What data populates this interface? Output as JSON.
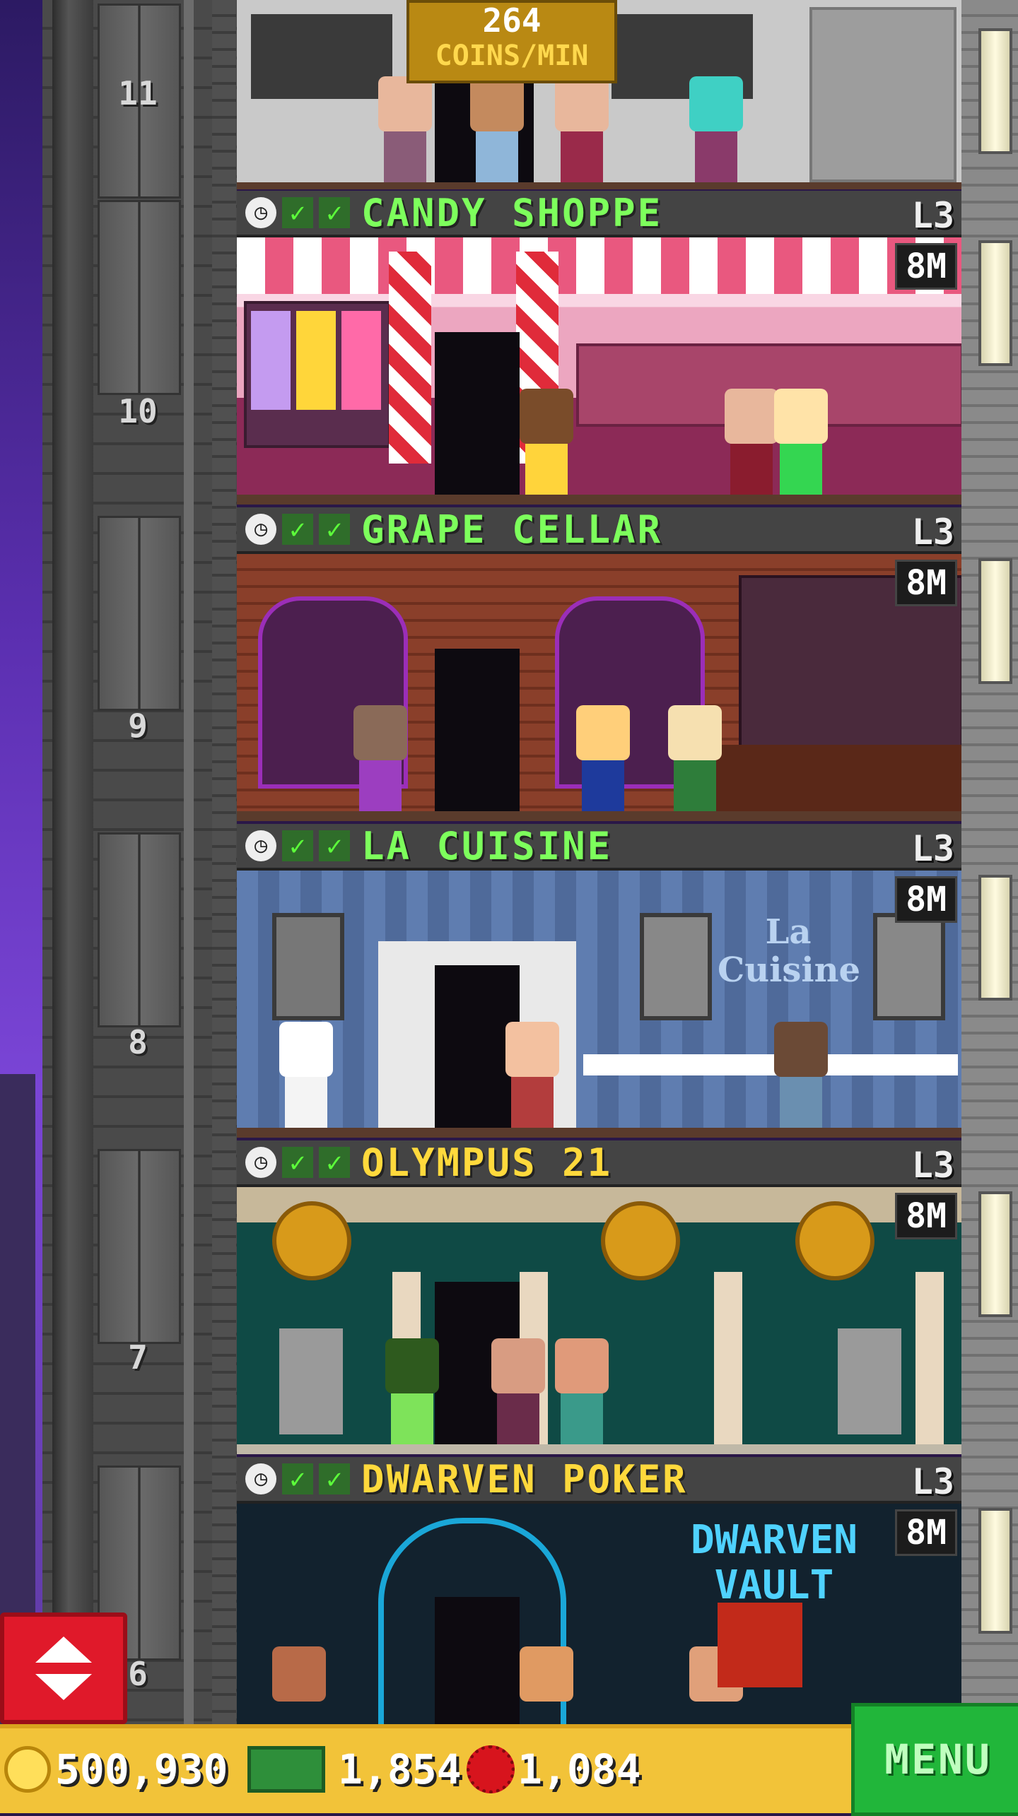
{
  "income": {
    "value": "264",
    "unit": "COINS/MIN"
  },
  "floors": [
    {
      "number": "11"
    },
    {
      "number": "10",
      "name": "CANDY SHOPPE",
      "level": "L3",
      "stock": "8M",
      "name_color": "#7dff5c"
    },
    {
      "number": "9",
      "name": "GRAPE CELLAR",
      "level": "L3",
      "stock": "8M",
      "name_color": "#7dff5c"
    },
    {
      "number": "8",
      "name": "LA CUISINE",
      "level": "L3",
      "stock": "8M",
      "name_color": "#7dff5c"
    },
    {
      "number": "7",
      "name": "OLYMPUS 21",
      "level": "L3",
      "stock": "8M",
      "name_color": "#ffd93c"
    },
    {
      "number": "6",
      "name": "DWARVEN POKER",
      "level": "L3",
      "stock": "8M",
      "name_color": "#ffd93c"
    }
  ],
  "signs": {
    "la_cuisine": "La Cuisine",
    "dwarven": "DWARVEN VAULT"
  },
  "resources": {
    "coins": "500,930",
    "cash": "1,854",
    "bux": "1,084"
  },
  "menu": {
    "label": "MENU"
  },
  "icons": {
    "clock": "clock-icon",
    "check": "check-icon",
    "coin": "coin-icon",
    "cash": "cash-icon",
    "bux": "bux-icon",
    "elevator": "elevator-arrows-icon"
  }
}
